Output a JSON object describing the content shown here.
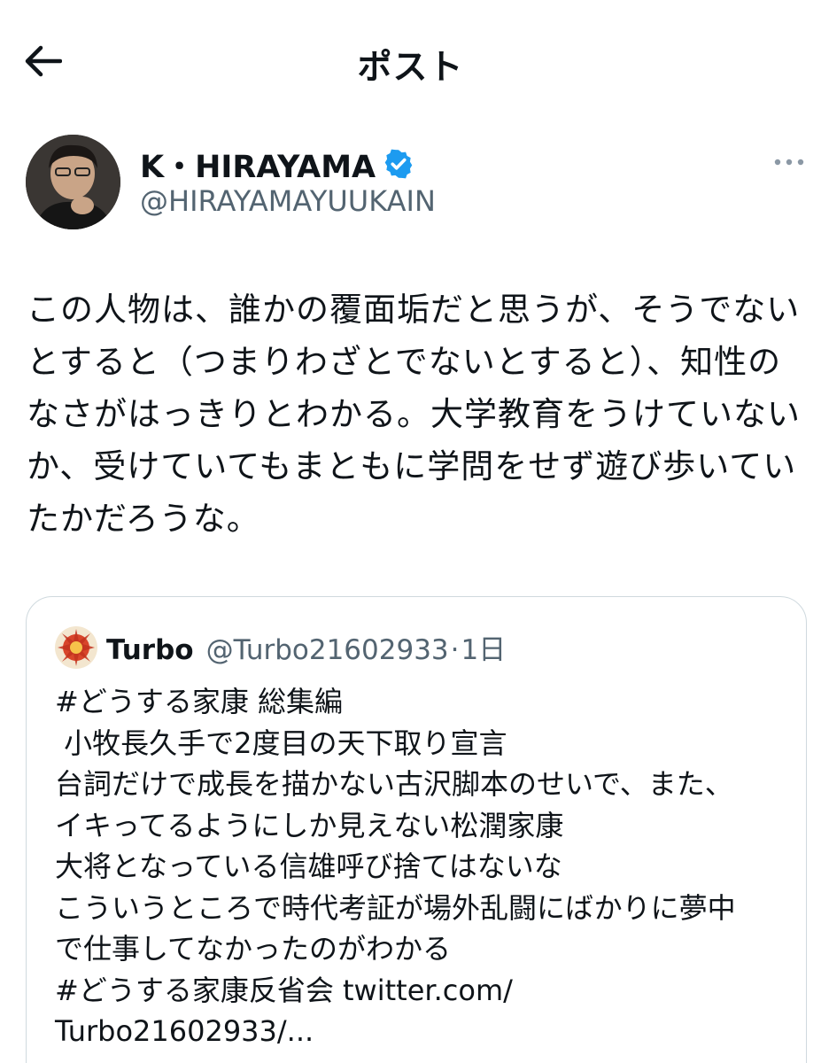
{
  "header": {
    "title": "ポスト"
  },
  "author": {
    "display_name": "K・HIRAYAMA",
    "handle": "@HIRAYAMAYUUKAIN"
  },
  "post": {
    "text": "この人物は、誰かの覆面垢だと思うが、そうでない\nとすると（つまりわざとでないとすると）、知性の\nなさがはっきりとわかる。大学教育をうけていない\nか、受けていてもまともに学問をせず遊び歩いてい\nたかだろうな。"
  },
  "quoted": {
    "display_name": "Turbo",
    "handle": "@Turbo21602933",
    "separator": "·",
    "time": "1日",
    "text": "#どうする家康 総集編\n 小牧長久手で2度目の天下取り宣言\n台詞だけで成長を描かない古沢脚本のせいで、また、\nイキってるようにしか見えない松潤家康\n大将となっている信雄呼び捨てはないな\nこういうところで時代考証が場外乱闘にばかりに夢中\nで仕事してなかったのがわかる\n#どうする家康反省会 twitter.com/\nTurbo21602933/..."
  },
  "colors": {
    "verified_blue": "#1d9bf0",
    "secondary_text": "#536471",
    "border": "#cfd9de"
  },
  "icons": {
    "back": "arrow-left-icon",
    "verified": "verified-badge-icon",
    "more": "more-dots-icon"
  }
}
